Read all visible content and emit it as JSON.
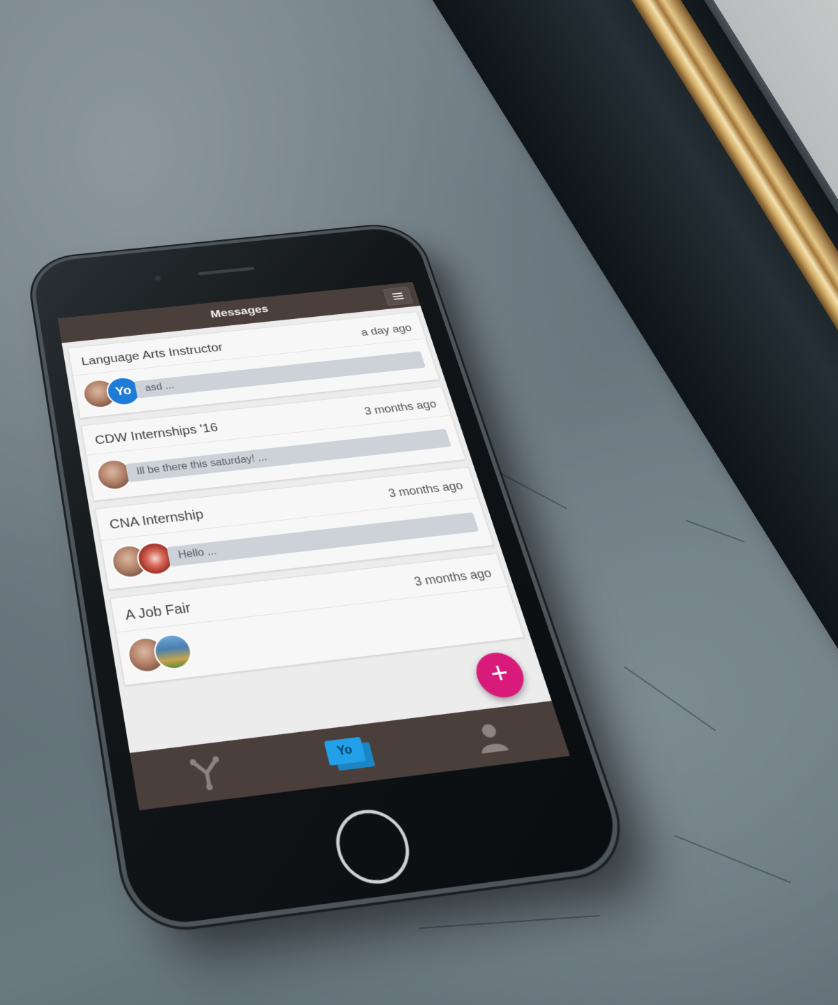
{
  "header": {
    "title": "Messages"
  },
  "conversations": [
    {
      "title": "Language Arts Instructor",
      "time": "a day ago",
      "preview": "asd ...",
      "brand_avatar_text": "Yo"
    },
    {
      "title": "CDW Internships '16",
      "time": "3 months ago",
      "preview": "Ill be there this saturday! ..."
    },
    {
      "title": "CNA Internship",
      "time": "3 months ago",
      "preview": "Hello ..."
    },
    {
      "title": "A Job Fair",
      "time": "3 months ago",
      "preview": ""
    }
  ],
  "fab": {
    "label": "+"
  },
  "tabbar": {
    "items": [
      {
        "icon": "network-icon"
      },
      {
        "icon": "chat-icon",
        "text": "Yo"
      },
      {
        "icon": "profile-icon"
      }
    ]
  },
  "colors": {
    "header_bg": "#4a3f3a",
    "fab": "#d81b7b",
    "accent_blue": "#23a0ea",
    "preview_bubble": "#ccd2d8"
  }
}
